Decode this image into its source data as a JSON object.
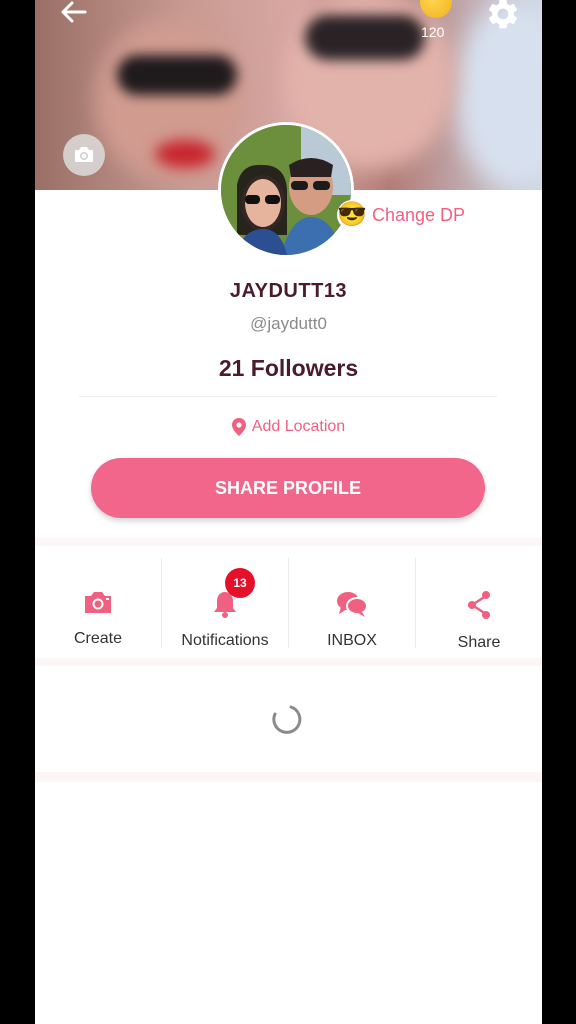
{
  "header": {
    "coin_count": "120"
  },
  "profile": {
    "change_dp_label": "Change DP",
    "change_dp_emoji": "😎",
    "username": "JAYDUTT13",
    "handle": "@jaydutt0",
    "followers": "21 Followers",
    "location": "Add Location",
    "share_button": "SHARE PROFILE"
  },
  "actions": [
    {
      "label": "Create",
      "icon": "camera-icon"
    },
    {
      "label": "Notifications",
      "icon": "bell-icon",
      "badge": "13"
    },
    {
      "label": "INBOX",
      "icon": "chat-icon"
    },
    {
      "label": "Share",
      "icon": "share-icon"
    }
  ],
  "colors": {
    "accent": "#f06081",
    "button": "#f2668c",
    "badge": "#e7102a",
    "title": "#4a1c2a"
  }
}
